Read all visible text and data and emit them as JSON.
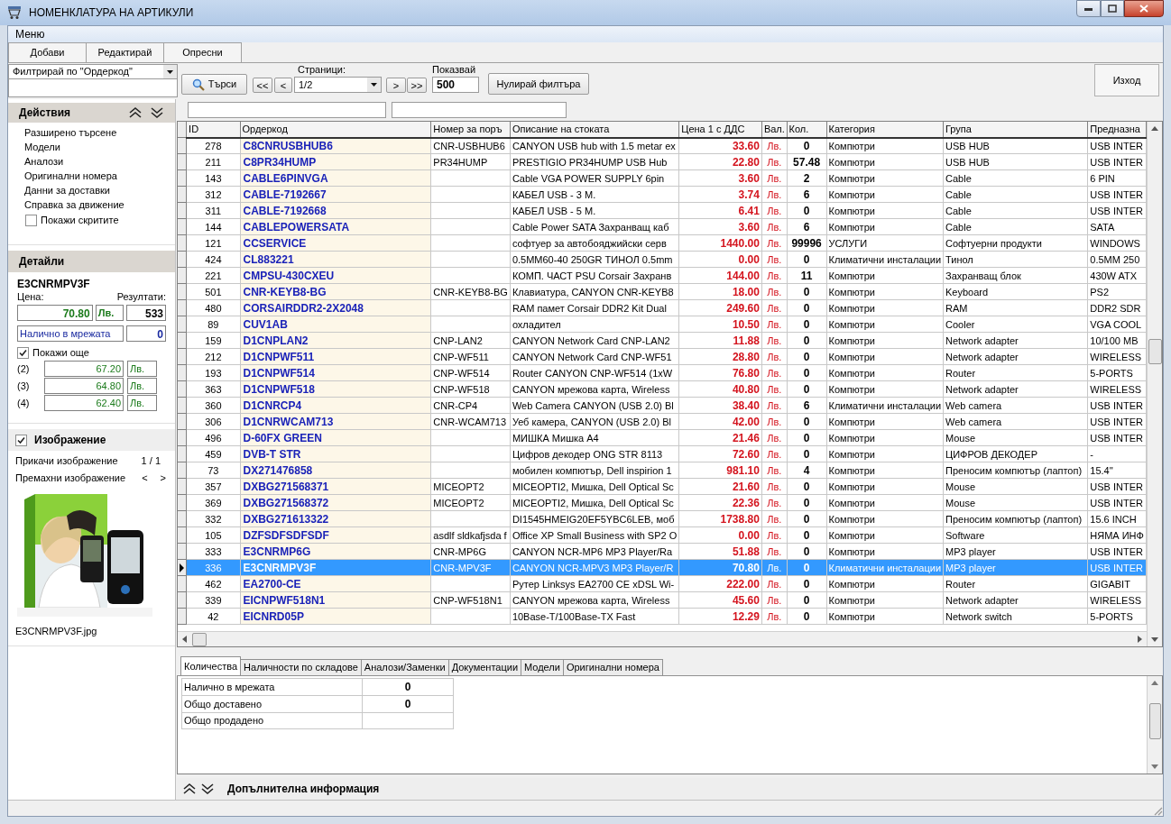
{
  "window": {
    "title": "НОМЕНКЛАТУРА НА АРТИКУЛИ"
  },
  "menu": [
    "Меню"
  ],
  "toolbar": [
    "Добави",
    "Редактирай",
    "Опресни"
  ],
  "filter": {
    "field": "Филтрирай по \"Ордеркод\"",
    "search_button": "Търси",
    "pages_label": "Страници:",
    "first": "<<",
    "prev": "<",
    "page": "1/2",
    "next": ">",
    "last": ">>",
    "show_label": "Показвай",
    "show_value": "500",
    "reset_button": "Нулирай филтъра",
    "exit_button": "Изход"
  },
  "actions": {
    "title": "Действия",
    "items": [
      "Разширено търсене",
      "Модели",
      "Аналози",
      "Оригинални номера",
      "Данни за доставки",
      "Справка за движение"
    ],
    "show_hidden": {
      "label": "Покажи скритите",
      "checked": false
    }
  },
  "details": {
    "title": "Детайли",
    "code": "E3CNRMPV3F",
    "price_label": "Цена:",
    "results_label": "Резултати:",
    "price": "70.80",
    "currency": "Лв.",
    "results": "533",
    "stock_label": "Налично в мрежата",
    "stock_value": "0",
    "show_more": {
      "label": "Покажи още",
      "checked": true
    },
    "prices": [
      {
        "label": "(2)",
        "value": "67.20",
        "currency": "Лв."
      },
      {
        "label": "(3)",
        "value": "64.80",
        "currency": "Лв."
      },
      {
        "label": "(4)",
        "value": "62.40",
        "currency": "Лв."
      }
    ]
  },
  "image": {
    "label": "Изображение",
    "checked": true,
    "attach": "Прикачи изображение",
    "counter": "1 / 1",
    "remove": "Премахни изображение",
    "prev": "<",
    "next": ">",
    "filename": "E3CNRMPV3F.jpg"
  },
  "table": {
    "columns": [
      "ID",
      "Ордеркод",
      "Номер за поръ",
      "Описание на стоката",
      "Цена 1 с ДДС",
      "Вал.",
      "Кол.",
      "Категория",
      "Група",
      "Предназна"
    ],
    "rows": [
      {
        "selected": false,
        "cells": [
          "278",
          "C8CNRUSBHUB6",
          "CNR-USBHUB6",
          "CANYON USB hub with 1.5 metar ex",
          "33.60",
          "Лв.",
          "0",
          "Компютри",
          "USB HUB",
          "USB INTER"
        ]
      },
      {
        "selected": false,
        "cells": [
          "211",
          "C8PR34HUMP",
          "PR34HUMP",
          "PRESTIGIO PR34HUMP USB Hub",
          "22.80",
          "Лв.",
          "57.48",
          "Компютри",
          "USB HUB",
          "USB INTER"
        ]
      },
      {
        "selected": false,
        "cells": [
          "143",
          "CABLE6PINVGA",
          "",
          "Cable VGA POWER SUPPLY 6pin",
          "3.60",
          "Лв.",
          "2",
          "Компютри",
          "Cable",
          "6 PIN"
        ]
      },
      {
        "selected": false,
        "cells": [
          "312",
          "CABLE-7192667",
          "",
          "КАБЕЛ USB - 3 М.",
          "3.74",
          "Лв.",
          "6",
          "Компютри",
          "Cable",
          "USB INTER"
        ]
      },
      {
        "selected": false,
        "cells": [
          "311",
          "CABLE-7192668",
          "",
          "КАБЕЛ USB - 5 М.",
          "6.41",
          "Лв.",
          "0",
          "Компютри",
          "Cable",
          "USB INTER"
        ]
      },
      {
        "selected": false,
        "cells": [
          "144",
          "CABLEPOWERSATA",
          "",
          "Cable Power SATA Захранващ каб",
          "3.60",
          "Лв.",
          "6",
          "Компютри",
          "Cable",
          "SATA"
        ]
      },
      {
        "selected": false,
        "cells": [
          "121",
          "CCSERVICE",
          "",
          "софтуер за автобояджийски серв",
          "1440.00",
          "Лв.",
          "99996",
          "УСЛУГИ",
          "Софтуерни продукти",
          "WINDOWS"
        ]
      },
      {
        "selected": false,
        "cells": [
          "424",
          "CL883221",
          "",
          "0.5MM60-40 250GR ТИНОЛ 0.5mm",
          "0.00",
          "Лв.",
          "0",
          "Климатични инсталации",
          "Тинол",
          "0.5MM 250"
        ]
      },
      {
        "selected": false,
        "cells": [
          "221",
          "CMPSU-430CXEU",
          "",
          "КОМП. ЧАСТ PSU Corsair Захранв",
          "144.00",
          "Лв.",
          "11",
          "Компютри",
          "Захранващ блок",
          "430W ATX"
        ]
      },
      {
        "selected": false,
        "cells": [
          "501",
          "CNR-KEYB8-BG",
          "CNR-KEYB8-BG",
          "Клавиатура, CANYON CNR-KEYB8",
          "18.00",
          "Лв.",
          "0",
          "Компютри",
          "Keyboard",
          "PS2"
        ]
      },
      {
        "selected": false,
        "cells": [
          "480",
          "CORSAIRDDR2-2X2048",
          "",
          "RAM памет Corsair DDR2 Kit Dual",
          "249.60",
          "Лв.",
          "0",
          "Компютри",
          "RAM",
          "DDR2 SDR"
        ]
      },
      {
        "selected": false,
        "cells": [
          "89",
          "CUV1AB",
          "",
          "охладител",
          "10.50",
          "Лв.",
          "0",
          "Компютри",
          "Cooler",
          "VGA COOL"
        ]
      },
      {
        "selected": false,
        "cells": [
          "159",
          "D1CNPLAN2",
          "CNP-LAN2",
          "CANYON Network Card CNP-LAN2",
          "11.88",
          "Лв.",
          "0",
          "Компютри",
          "Network adapter",
          "10/100 MB"
        ]
      },
      {
        "selected": false,
        "cells": [
          "212",
          "D1CNPWF511",
          "CNP-WF511",
          "CANYON Network Card CNP-WF51",
          "28.80",
          "Лв.",
          "0",
          "Компютри",
          "Network adapter",
          "WIRELESS"
        ]
      },
      {
        "selected": false,
        "cells": [
          "193",
          "D1CNPWF514",
          "CNP-WF514",
          "Router CANYON CNP-WF514 (1xW",
          "76.80",
          "Лв.",
          "0",
          "Компютри",
          "Router",
          "5-PORTS"
        ]
      },
      {
        "selected": false,
        "cells": [
          "363",
          "D1CNPWF518",
          "CNP-WF518",
          "CANYON мрежова карта, Wireless",
          "40.80",
          "Лв.",
          "0",
          "Компютри",
          "Network adapter",
          "WIRELESS"
        ]
      },
      {
        "selected": false,
        "cells": [
          "360",
          "D1CNRCP4",
          "CNR-CP4",
          "Web Camera CANYON (USB 2.0) Bl",
          "38.40",
          "Лв.",
          "6",
          "Климатични инсталации",
          "Web camera",
          "USB INTER"
        ]
      },
      {
        "selected": false,
        "cells": [
          "306",
          "D1CNRWCAM713",
          "CNR-WCAM713",
          "Уеб камера, CANYON (USB 2.0) Bl",
          "42.00",
          "Лв.",
          "0",
          "Компютри",
          "Web camera",
          "USB INTER"
        ]
      },
      {
        "selected": false,
        "cells": [
          "496",
          "D-60FX GREEN",
          "",
          "МИШКА Мишка А4",
          "21.46",
          "Лв.",
          "0",
          "Компютри",
          "Mouse",
          "USB INTER"
        ]
      },
      {
        "selected": false,
        "cells": [
          "459",
          "DVB-T STR",
          "",
          "Цифров декодер ONG STR 8113",
          "72.60",
          "Лв.",
          "0",
          "Компютри",
          "ЦИФРОВ ДЕКОДЕР",
          "-"
        ]
      },
      {
        "selected": false,
        "cells": [
          "73",
          "DX271476858",
          "",
          "мобилен компютър, Dell inspirion 1",
          "981.10",
          "Лв.",
          "4",
          "Компютри",
          "Преносим компютър (лаптоп)",
          "15.4''"
        ]
      },
      {
        "selected": false,
        "cells": [
          "357",
          "DXBG271568371",
          "MICEOPT2",
          "MICEOPTI2, Мишка, Dell Optical Sc",
          "21.60",
          "Лв.",
          "0",
          "Компютри",
          "Mouse",
          "USB INTER"
        ]
      },
      {
        "selected": false,
        "cells": [
          "369",
          "DXBG271568372",
          "MICEOPT2",
          "MICEOPTI2, Мишка, Dell Optical Sc",
          "22.36",
          "Лв.",
          "0",
          "Компютри",
          "Mouse",
          "USB INTER"
        ]
      },
      {
        "selected": false,
        "cells": [
          "332",
          "DXBG271613322",
          "",
          "DI1545HMEIG20EF5YBC6LEB, моб",
          "1738.80",
          "Лв.",
          "0",
          "Компютри",
          "Преносим компютър (лаптоп)",
          "15.6 INCH"
        ]
      },
      {
        "selected": false,
        "cells": [
          "105",
          "DZFSDFSDFSDF",
          "asdlf sldkafjsda f",
          "Office XP Small Business with SP2 O",
          "0.00",
          "Лв.",
          "0",
          "Компютри",
          "Software",
          "НЯМА ИНФ"
        ]
      },
      {
        "selected": false,
        "cells": [
          "333",
          "E3CNRMP6G",
          "CNR-MP6G",
          "CANYON NCR-MP6 MP3 Player/Ra",
          "51.88",
          "Лв.",
          "0",
          "Компютри",
          "MP3 player",
          "USB INTER"
        ]
      },
      {
        "selected": true,
        "cells": [
          "336",
          "E3CNRMPV3F",
          "CNR-MPV3F",
          "CANYON NCR-MPV3 MP3 Player/R",
          "70.80",
          "Лв.",
          "0",
          "Климатични инсталации",
          "MP3 player",
          "USB INTER"
        ]
      },
      {
        "selected": false,
        "cells": [
          "462",
          "EA2700-CE",
          "",
          "Рутер Linksys EA2700 CE xDSL Wi-",
          "222.00",
          "Лв.",
          "0",
          "Компютри",
          "Router",
          "GIGABIT"
        ]
      },
      {
        "selected": false,
        "cells": [
          "339",
          "EICNPWF518N1",
          "CNP-WF518N1",
          "CANYON мрежова карта, Wireless",
          "45.60",
          "Лв.",
          "0",
          "Компютри",
          "Network adapter",
          "WIRELESS"
        ]
      },
      {
        "selected": false,
        "cells": [
          "42",
          "EICNRD05P",
          "",
          "10Base-T/100Base-TX Fast",
          "12.29",
          "Лв.",
          "0",
          "Компютри",
          "Network switch",
          "5-PORTS"
        ]
      }
    ]
  },
  "bottom_tabs": [
    {
      "label": "Количества",
      "selected": true
    },
    {
      "label": "Наличности по складове",
      "selected": false
    },
    {
      "label": "Аналози/Заменки",
      "selected": false
    },
    {
      "label": "Документации",
      "selected": false
    },
    {
      "label": "Модели",
      "selected": false
    },
    {
      "label": "Оригинални номера",
      "selected": false
    }
  ],
  "quantities": [
    {
      "label": "Налично в мрежата",
      "value": "0"
    },
    {
      "label": "Общо доставено",
      "value": "0"
    },
    {
      "label": "Общо продадено"
    }
  ],
  "footer": {
    "title": "Допълнителна информация"
  }
}
